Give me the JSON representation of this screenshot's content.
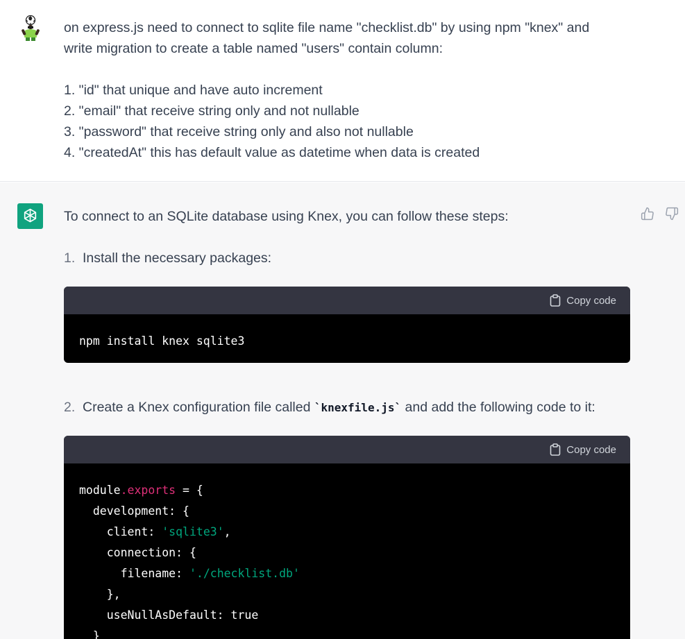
{
  "user": {
    "avatar_icon": "soccer-player-avatar-icon",
    "line1": "on express.js need to connect to sqlite file name \"checklist.db\" by using npm \"knex\" and",
    "line2": "write migration to create a table named \"users\" contain column:",
    "items": [
      "1. \"id\" that unique and have auto increment",
      "2. \"email\" that receive string only and not nullable",
      "3. \"password\" that receive string only and also not nullable",
      "4. \"createdAt\" this has default value as datetime when data is created"
    ]
  },
  "assistant": {
    "avatar_icon": "openai-logo-icon",
    "intro": "To connect to an SQLite database using Knex, you can follow these steps:",
    "steps": [
      {
        "num": "1.",
        "text": "Install the necessary packages:"
      },
      {
        "num": "2.",
        "text_before": "Create a Knex configuration file called ",
        "code": "`knexfile.js`",
        "text_after": " and add the following code to it:"
      }
    ],
    "copy_label": "Copy code",
    "code1": "npm install knex sqlite3",
    "code2": {
      "l1_a": "module",
      "l1_b": ".exports",
      "l1_c": " = {",
      "l2": "  development: {",
      "l3_a": "    client: ",
      "l3_b": "'sqlite3'",
      "l3_c": ",",
      "l4": "    connection: {",
      "l5_a": "      filename: ",
      "l5_b": "'./checklist.db'",
      "l6": "    },",
      "l7": "    useNullAsDefault: true",
      "l8": "  }"
    }
  },
  "colors": {
    "accent": "#10a37f",
    "code_bg": "#000000",
    "code_header": "#343541",
    "string": "#00a67d",
    "property": "#df3079"
  }
}
